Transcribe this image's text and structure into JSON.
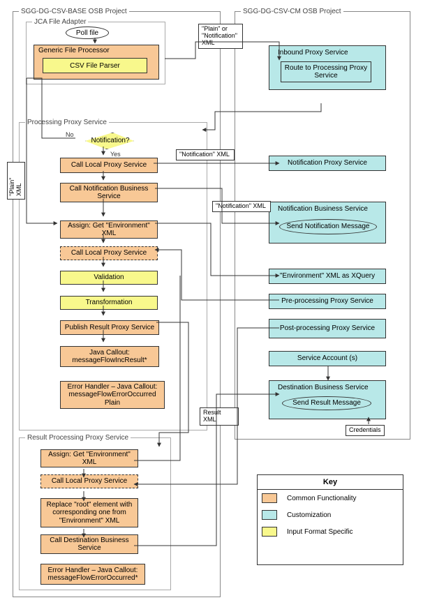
{
  "left_project_title": "SGG-DG-CSV-BASE OSB Project",
  "right_project_title": "SGG-DG-CSV-CM OSB Project",
  "jca": {
    "title": "JCA File Adapter",
    "poll": "Poll file",
    "gfp": "Generic File Processor",
    "parser": "CSV File Parser"
  },
  "pps": {
    "title": "Processing Proxy Service",
    "decision": "Notification?",
    "no": "No",
    "yes": "Yes",
    "call_local1": "Call Local Proxy Service",
    "call_notif_bs": "Call Notification Business Service",
    "assign_env": "Assign: Get \"Environment\" XML",
    "call_local2": "Call Local Proxy Service",
    "validation": "Validation",
    "transformation": "Transformation",
    "publish_result": "Publish Result Proxy Service",
    "java_callout_inc": "Java Callout: messageFlowIncResult*",
    "error_handler": "Error Handler – Java Callout: messageFlowErrorOccurred Plain"
  },
  "rpps": {
    "title": "Result Processing Proxy Service",
    "assign_env": "Assign: Get \"Environment\" XML",
    "call_local": "Call Local Proxy Service",
    "replace_root": "Replace \"root\" element with corresponding one from \"Environment\" XML",
    "call_dest_bs": "Call Destination Business Service",
    "error_handler": "Error Handler – Java Callout: messageFlowErrorOccurred*"
  },
  "right": {
    "inbound_title": "Inbound Proxy Service",
    "route_to": "Route to Processing Proxy Service",
    "notif_proxy": "Notification Proxy Service",
    "notif_bs_title": "Notification Business Service",
    "send_notif": "Send Notification Message",
    "env_xquery": "\"Environment\" XML as XQuery",
    "preproc": "Pre-processing Proxy Service",
    "postproc": "Post-processing Proxy Service",
    "svc_account": "Service Account (s)",
    "dest_bs_title": "Destination Business Service",
    "send_result": "Send Result Message",
    "credentials": "Credentials"
  },
  "callouts": {
    "plain_or_notif": "\"Plain\" or \"Notification\" XML",
    "plain_xml": "\"Plain\" XML",
    "notif_xml1": "\"Notification\" XML",
    "notif_xml2": "\"Notification\" XML",
    "result_xml": "Result XML"
  },
  "key": {
    "title": "Key",
    "common": "Common Functionality",
    "custom": "Customization",
    "input": "Input Format Specific"
  }
}
